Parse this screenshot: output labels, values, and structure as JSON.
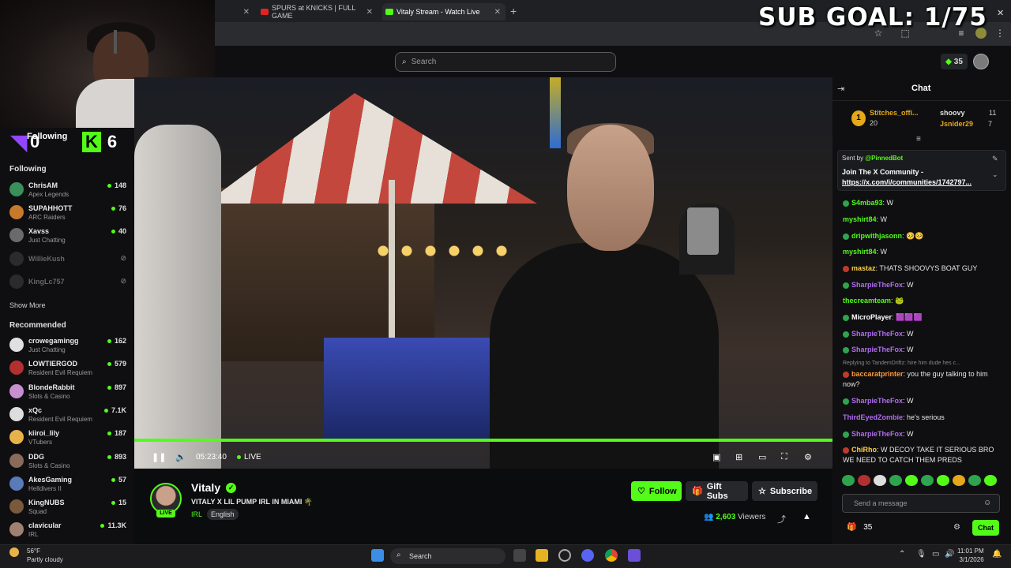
{
  "browser": {
    "tabs": [
      {
        "label": "",
        "fav_color": "#888888"
      },
      {
        "label": "SPURS at KNICKS | FULL GAME",
        "fav_color": "#e02424"
      },
      {
        "label": "Vitaly Stream - Watch Live",
        "fav_color": "#53fc18"
      }
    ],
    "new_tab": "+"
  },
  "overlay": {
    "sub_goal": "SUB GOAL: 1/75",
    "counter_twitch": "0",
    "counter_kick": "6",
    "following_label": "Following"
  },
  "site": {
    "search_placeholder": "Search",
    "points": "35"
  },
  "sidebar": {
    "following_heading": "Following",
    "following": [
      {
        "name": "ChrisAM",
        "category": "Apex Legends",
        "viewers": "148",
        "color": "#3a8f5a"
      },
      {
        "name": "SUPAHHOTT",
        "category": "ARC Raiders",
        "viewers": "76",
        "color": "#c77a2a"
      },
      {
        "name": "Xavss",
        "category": "Just Chatting",
        "viewers": "40",
        "color": "#6a6a6a"
      },
      {
        "name": "WillieKush",
        "category": "",
        "viewers": "",
        "color": "#555555"
      },
      {
        "name": "KingLc757",
        "category": "",
        "viewers": "",
        "color": "#555555"
      }
    ],
    "show_more": "Show More",
    "recommended_heading": "Recommended",
    "recommended": [
      {
        "name": "crowegamingg",
        "category": "Just Chatting",
        "viewers": "162",
        "color": "#e0e0e0"
      },
      {
        "name": "LOWTIERGOD",
        "category": "Resident Evil Requiem",
        "viewers": "579",
        "color": "#b23030"
      },
      {
        "name": "BlondeRabbit",
        "category": "Slots & Casino",
        "viewers": "897",
        "color": "#c78fd0"
      },
      {
        "name": "xQc",
        "category": "Resident Evil Requiem",
        "viewers": "7.1K",
        "color": "#dddddd"
      },
      {
        "name": "kiiroi_lily",
        "category": "VTubers",
        "viewers": "187",
        "color": "#e8b24a"
      },
      {
        "name": "DDG",
        "category": "Slots & Casino",
        "viewers": "893",
        "color": "#8a6a5a"
      },
      {
        "name": "AkesGaming",
        "category": "Helldivers II",
        "viewers": "57",
        "color": "#5a7ab8"
      },
      {
        "name": "KingNUBS",
        "category": "Squad",
        "viewers": "15",
        "color": "#7a5a3a"
      },
      {
        "name": "clavicular",
        "category": "IRL",
        "viewers": "11.3K",
        "color": "#a08070"
      }
    ]
  },
  "player": {
    "time": "05:23:40",
    "live_label": "LIVE"
  },
  "stream": {
    "streamer": "Vitaly",
    "live_badge": "LIVE",
    "title": "VITALY X LIL PUMP IRL IN MIAMI 🌴",
    "category": "IRL",
    "tag": "English",
    "follow_label": "Follow",
    "gift_label": "Gift Subs",
    "subscribe_label": "Subscribe",
    "viewers_count": "2,603",
    "viewers_label": "Viewers"
  },
  "chat": {
    "title": "Chat",
    "leaderboard": [
      {
        "name": "Stitches_offi...",
        "count": "20",
        "color": "#e4a81a"
      },
      {
        "name": "shoovy",
        "count": "11",
        "color": "#e0e0e0"
      },
      {
        "name": "Jsnider29",
        "count": "7",
        "color": "#e4a81a"
      }
    ],
    "pinned_sent_prefix": "Sent by",
    "pinned_sender": "@PinnedBot",
    "pinned_text": "Join The X Community -",
    "pinned_link": "https://x.com/i/communities/1742797...",
    "messages": [
      {
        "user": "S4mba93",
        "text": "W",
        "color": "#53fc18"
      },
      {
        "user": "myshirt84",
        "text": "W",
        "color": "#53fc18"
      },
      {
        "user": "dripwithjasonn",
        "text": "🥺🥺",
        "color": "#53fc18"
      },
      {
        "user": "myshirt84",
        "text": "W",
        "color": "#53fc18"
      },
      {
        "user": "mastaz",
        "text": "THATS SHOOVYS BOAT GUY",
        "color": "#ffd23e"
      },
      {
        "user": "SharpieTheFox",
        "text": "W",
        "color": "#b06cf0"
      },
      {
        "user": "thecreamteam",
        "text": "🐸",
        "color": "#53fc18"
      },
      {
        "user": "MicroPlayer",
        "text": "🟪🟪🟪",
        "color": "#ffffff"
      },
      {
        "user": "SharpieTheFox",
        "text": "W",
        "color": "#b06cf0"
      },
      {
        "user": "SharpieTheFox",
        "text": "W",
        "color": "#b06cf0"
      },
      {
        "user": "baccaratprinter",
        "text": "you the guy talking to him now?",
        "color": "#ff9a3a"
      },
      {
        "user": "SharpieTheFox",
        "text": "W",
        "color": "#b06cf0"
      },
      {
        "user": "ThirdEyedZombie",
        "text": "he's serious",
        "color": "#b06cf0"
      },
      {
        "user": "SharpieTheFox",
        "text": "W",
        "color": "#b06cf0"
      },
      {
        "user": "ChiRho",
        "text": "W DECOY TAKE IT SERIOUS BRO WE NEED TO CATCH THEM PREDS",
        "color": "#ffd23e"
      }
    ],
    "reply_text": "Replying to TandemDriftz: hire him dude hes c...",
    "input_placeholder": "Send a message",
    "gift_count": "35",
    "send_label": "Chat"
  },
  "taskbar": {
    "temp": "56°F",
    "weather": "Partly cloudy",
    "search": "Search",
    "time": "11:01 PM",
    "date": "3/1/2026"
  },
  "colors": {
    "accent": "#53fc18",
    "bg": "#0b0c0e"
  }
}
